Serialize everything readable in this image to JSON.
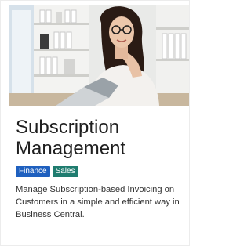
{
  "card": {
    "title": "Subscription Management",
    "tags": [
      {
        "label": "Finance",
        "color": "#1f60bf"
      },
      {
        "label": "Sales",
        "color": "#1f7c6f"
      }
    ],
    "description": "Manage Subscription-based Invoicing on Customers in a simple and efficient way in Business Central.",
    "image_icon": "office-woman-photo"
  }
}
